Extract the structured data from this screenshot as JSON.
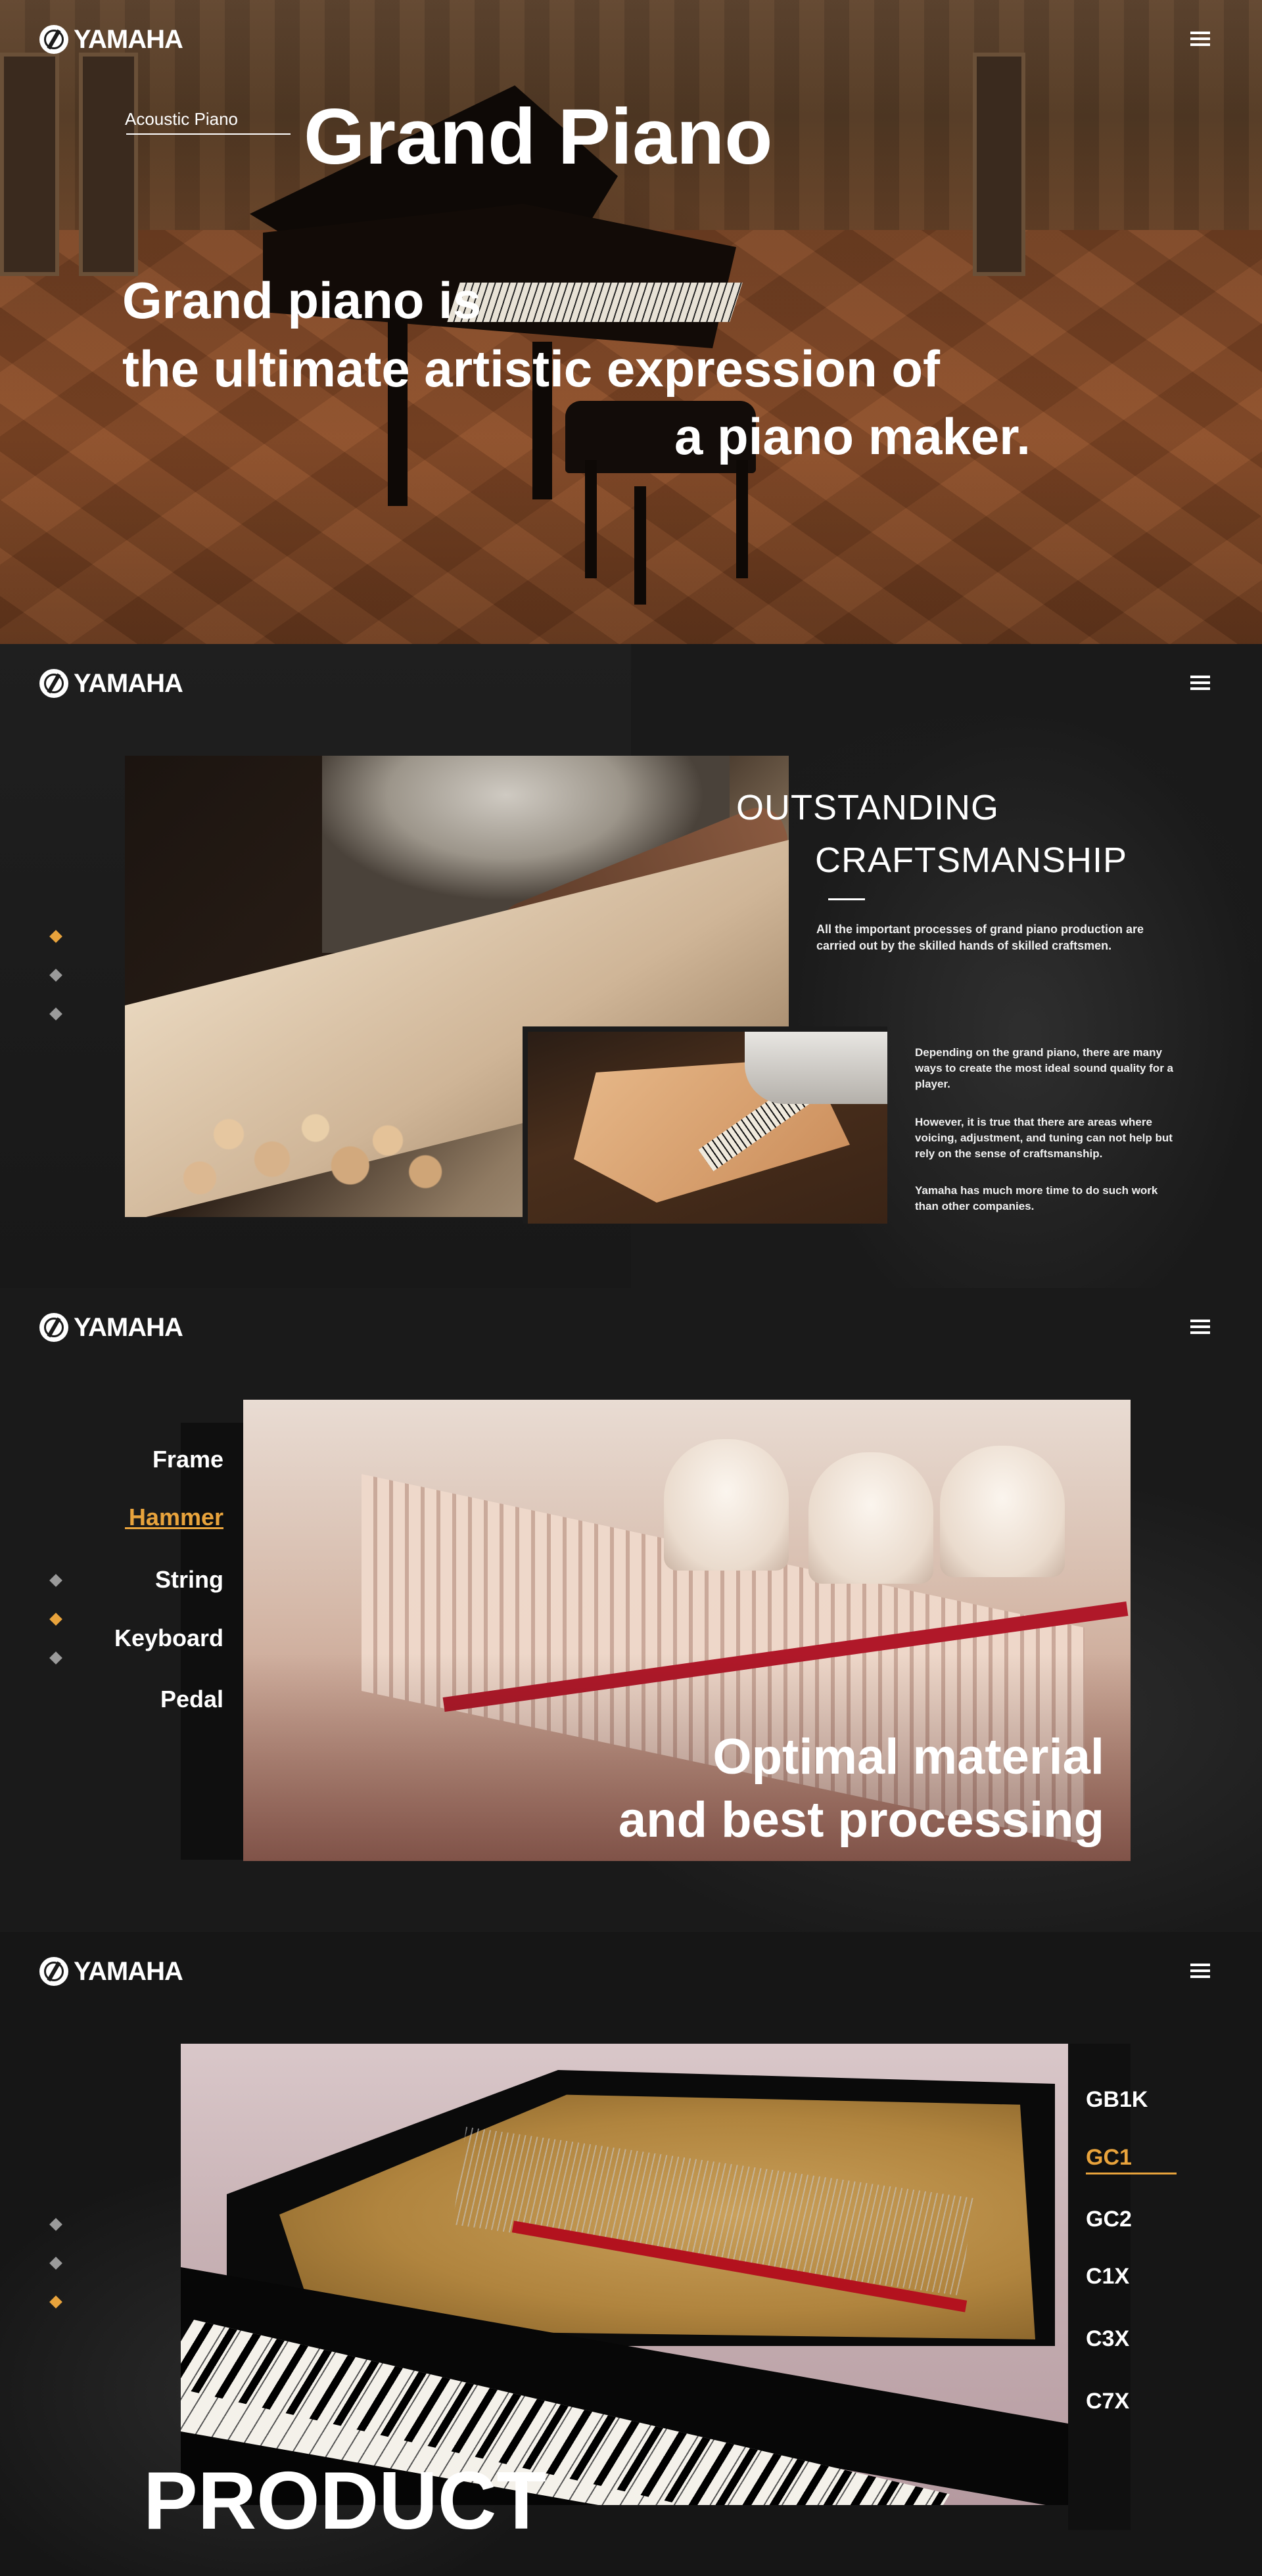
{
  "brand": {
    "name": "YAMAHA"
  },
  "icons": {
    "logo": "yamaha-tuning-fork-emblem",
    "menu": "hamburger-menu-icon",
    "nav_dot": "diamond-dot"
  },
  "colors": {
    "accent": "#e8a33c",
    "dark_bg": "#1b1b1b",
    "text": "#ffffff",
    "inactive_dot": "#9a9a9a"
  },
  "hero": {
    "category_label": "Acoustic Piano",
    "title": "Grand Piano",
    "tagline": [
      "Grand piano is",
      "the ultimate artistic expression of",
      "a piano maker."
    ]
  },
  "craftsmanship": {
    "title_line1": "OUTSTANDING",
    "title_line2": "CRAFTSMANSHIP",
    "lead": "All the important processes of grand piano production are carried out by the skilled hands of skilled craftsmen.",
    "paragraphs": [
      "Depending on the grand piano, there are many ways to create the most ideal sound quality for a player.",
      "However, it is true that there are areas where voicing, adjustment, and tuning can not help but rely on the sense of craftsmanship.",
      "Yamaha has much more time to do such work than other companies."
    ],
    "dots": [
      {
        "active": true
      },
      {
        "active": false
      },
      {
        "active": false
      }
    ]
  },
  "components": {
    "items": [
      "Frame",
      "Hammer",
      "String",
      "Keyboard",
      "Pedal"
    ],
    "active_item": "Hammer",
    "caption_line1": "Optimal material",
    "caption_line2": "and best processing",
    "dots": [
      {
        "active": false
      },
      {
        "active": true
      },
      {
        "active": false
      }
    ]
  },
  "product": {
    "title": "PRODUCT",
    "models": [
      "GB1K",
      "GC1",
      "GC2",
      "C1X",
      "C3X",
      "C7X"
    ],
    "active_model": "GC1",
    "dots": [
      {
        "active": false
      },
      {
        "active": false
      },
      {
        "active": true
      }
    ]
  }
}
